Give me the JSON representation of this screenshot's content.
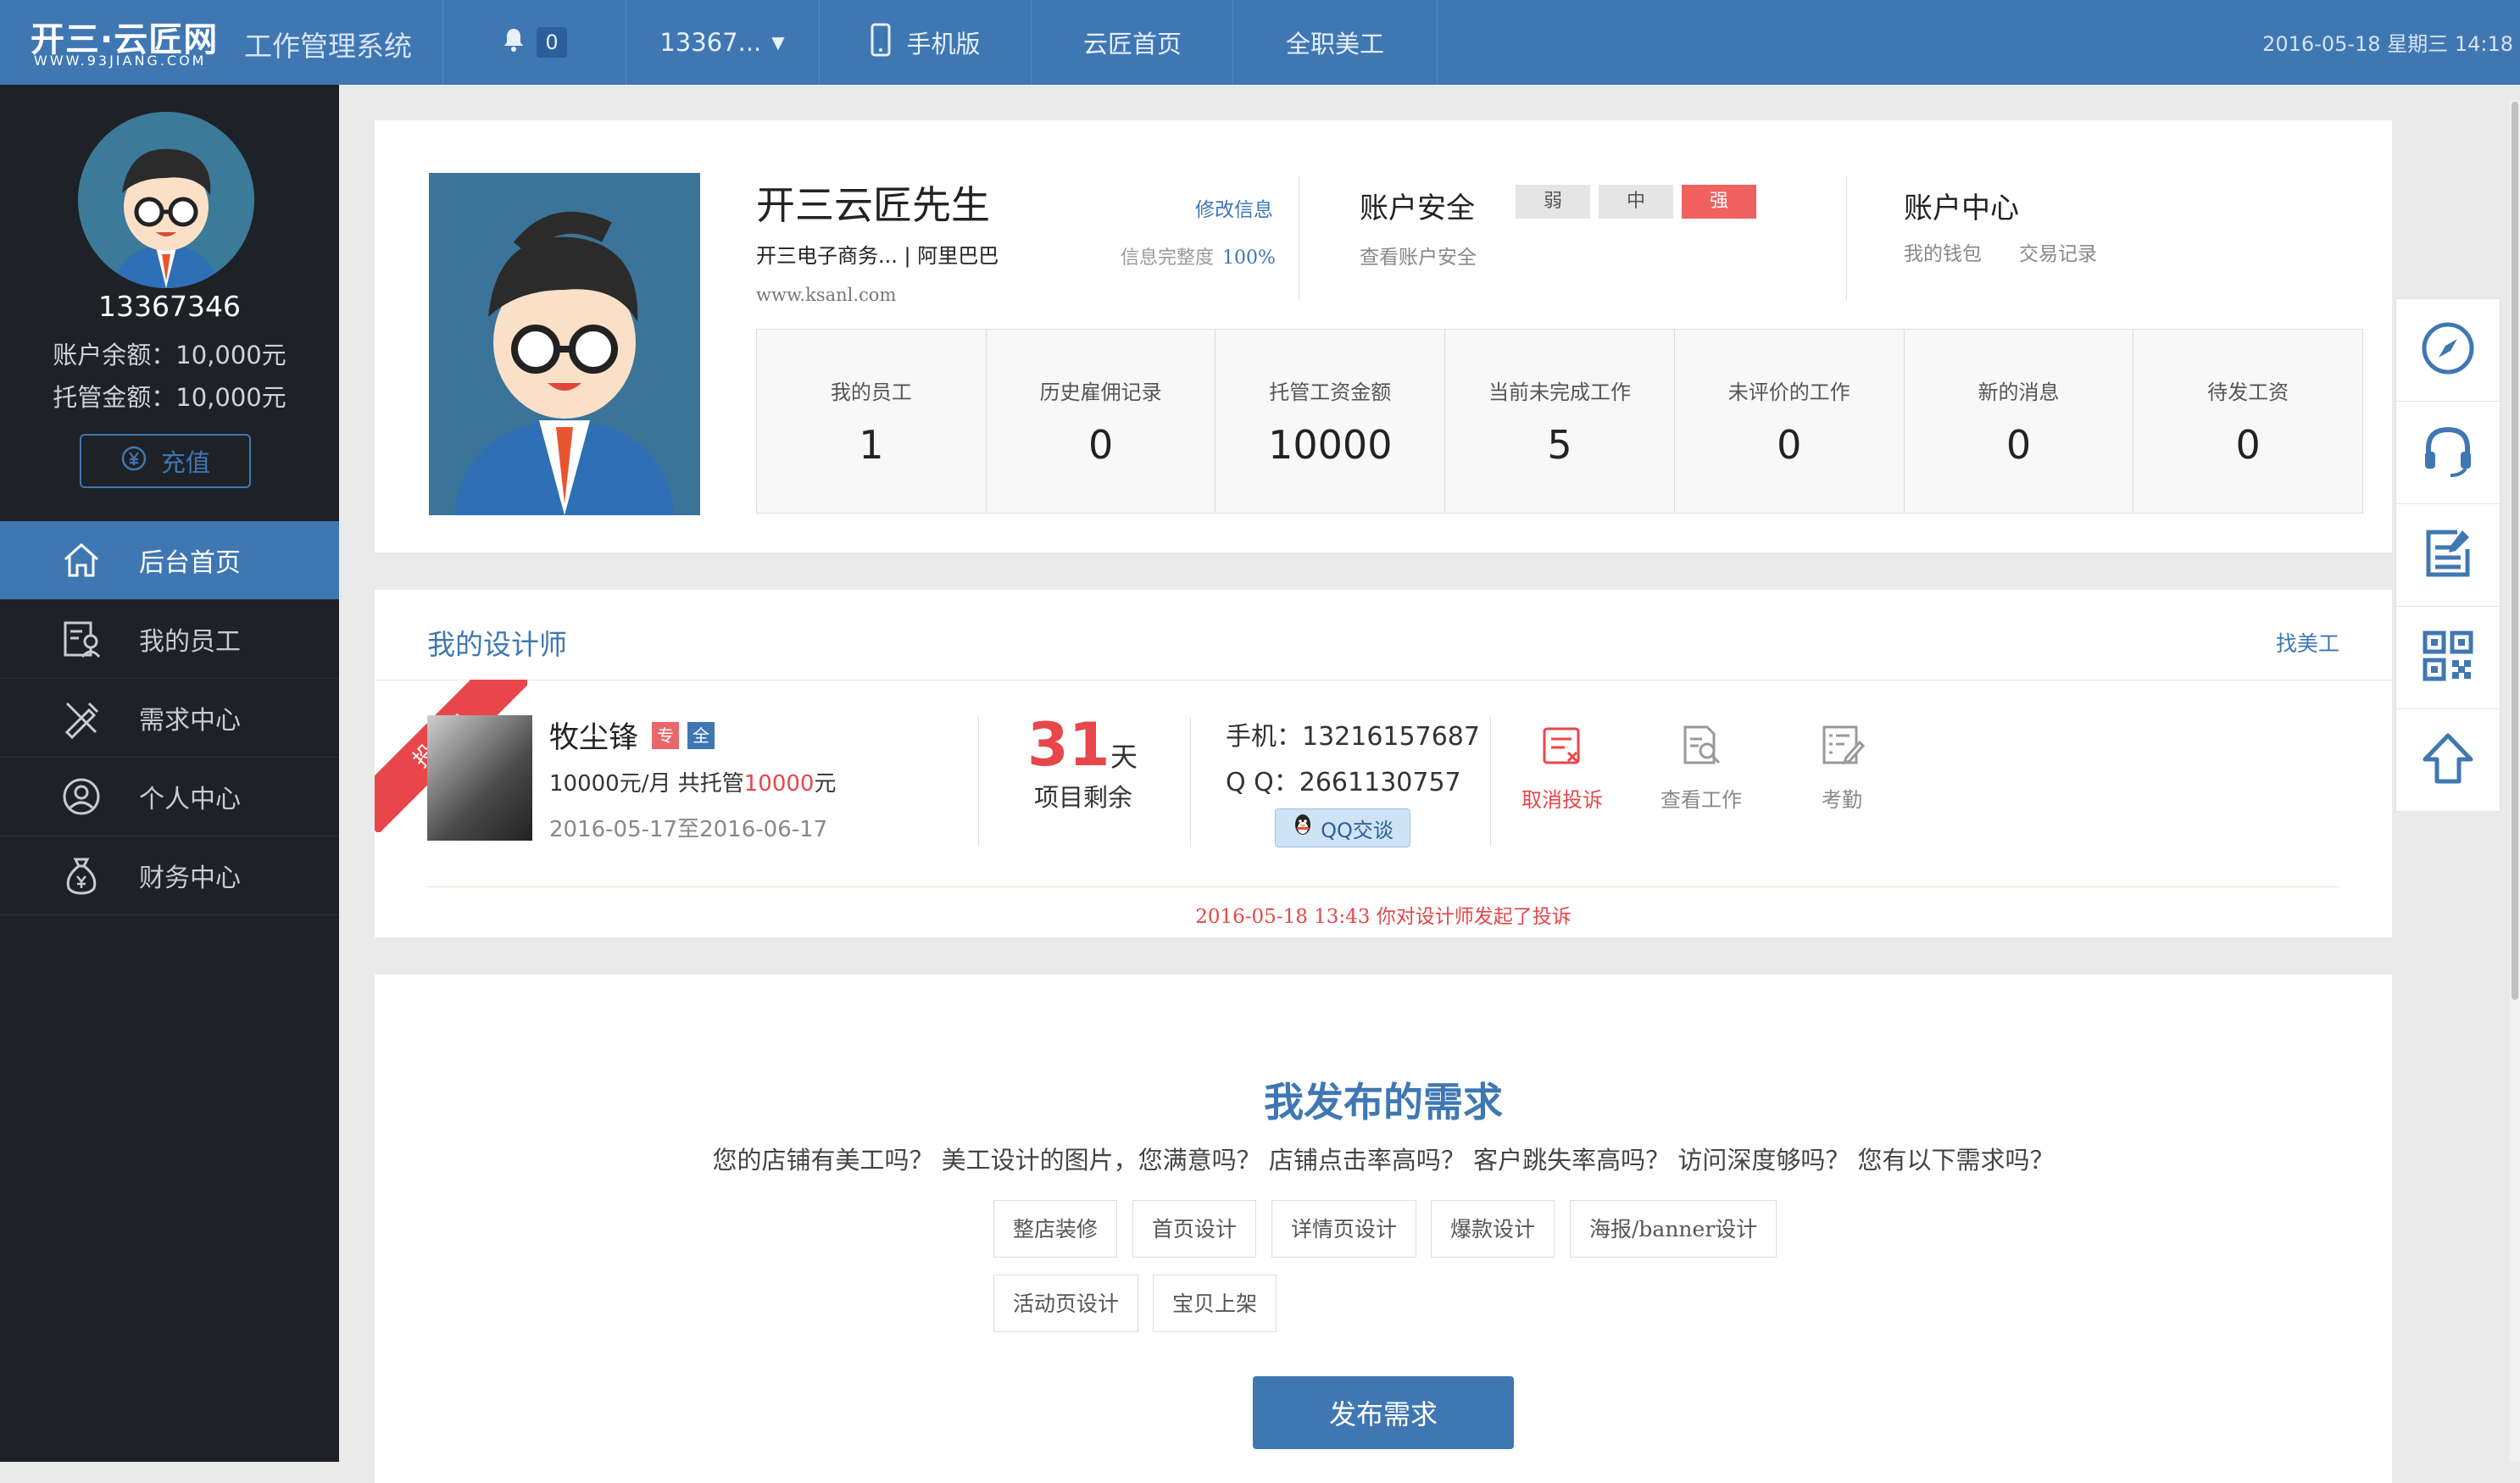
{
  "topbar": {
    "logo_main": "开三·云匠网",
    "logo_sub": "WWW.93JIANG.COM",
    "system_title": "工作管理系统",
    "notification_count": "0",
    "user_dropdown": "13367...",
    "mobile_label": "手机版",
    "home_label": "云匠首页",
    "fulltime_label": "全职美工",
    "datetime": "2016-05-18 星期三 14:18"
  },
  "sidebar": {
    "username": "13367346",
    "balance": "账户余额：10,000元",
    "escrow": "托管金额：10,000元",
    "recharge_label": "充值",
    "nav": [
      {
        "label": "后台首页",
        "icon": "home-icon"
      },
      {
        "label": "我的员工",
        "icon": "staff-icon"
      },
      {
        "label": "需求中心",
        "icon": "tools-icon"
      },
      {
        "label": "个人中心",
        "icon": "person-icon"
      },
      {
        "label": "财务中心",
        "icon": "money-bag-icon"
      }
    ]
  },
  "profile": {
    "name": "开三云匠先生",
    "edit_link": "修改信息",
    "company": "开三电子商务...  |  阿里巴巴",
    "completeness_label": "信息完整度",
    "completeness_value": "100%",
    "website": "www.ksanl.com",
    "security": {
      "title": "账户安全",
      "levels": [
        "弱",
        "中",
        "强"
      ],
      "active_level": "强",
      "view_link": "查看账户安全"
    },
    "account_center": {
      "title": "账户中心",
      "wallet": "我的钱包",
      "records": "交易记录"
    }
  },
  "stats": [
    {
      "label": "我的员工",
      "value": "1"
    },
    {
      "label": "历史雇佣记录",
      "value": "0"
    },
    {
      "label": "托管工资金额",
      "value": "10000"
    },
    {
      "label": "当前未完成工作",
      "value": "5"
    },
    {
      "label": "未评价的工作",
      "value": "0"
    },
    {
      "label": "新的消息",
      "value": "0"
    },
    {
      "label": "待发工资",
      "value": "0"
    }
  ],
  "designers": {
    "title": "我的设计师",
    "find_link": "找美工",
    "ribbon": "投诉中",
    "name": "牧尘锋",
    "tag_pro": "专",
    "tag_full": "全",
    "salary_prefix": "10000元/月 共托管",
    "salary_amount": "10000",
    "salary_suffix": "元",
    "period": "2016-05-17至2016-06-17",
    "days_num": "31",
    "days_unit": "天",
    "days_label": "项目剩余",
    "phone": "手机：13216157687",
    "qq": "Q Q：2661130757",
    "qq_btn": "QQ交谈",
    "actions": [
      "取消投诉",
      "查看工作",
      "考勤"
    ],
    "complaint_note": "2016-05-18 13:43 你对设计师发起了投诉"
  },
  "demand": {
    "title": "我发布的需求",
    "question": "您的店铺有美工吗？ 美工设计的图片，您满意吗？ 店铺点击率高吗？ 客户跳失率高吗？ 访问深度够吗？ 您有以下需求吗？",
    "tags": [
      "整店装修",
      "首页设计",
      "详情页设计",
      "爆款设计",
      "海报/banner设计",
      "活动页设计",
      "宝贝上架"
    ],
    "publish_label": "发布需求"
  },
  "colors": {
    "primary": "#3f77b3",
    "sidebar_bg": "#1e2125",
    "accent_red": "#e8464a"
  }
}
